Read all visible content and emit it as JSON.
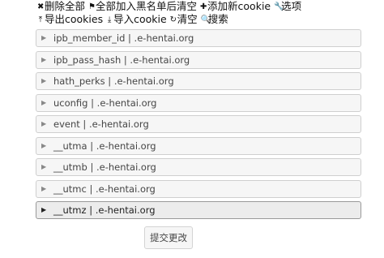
{
  "toolbar": {
    "delete_all": {
      "icon": "✖",
      "label": "删除全部"
    },
    "blacklist_clear": {
      "icon": "⚑",
      "label": "全部加入黑名单后清空"
    },
    "add_cookie": {
      "icon": "✚",
      "label": "添加新cookie"
    },
    "options": {
      "icon": "🔧",
      "label": "选项"
    },
    "export": {
      "icon": "⤒",
      "label": "导出cookies"
    },
    "import": {
      "icon": "⤓",
      "label": "导入cookie"
    },
    "clear": {
      "icon": "↻",
      "label": "清空"
    },
    "search": {
      "icon": "🔍",
      "label": "搜索"
    }
  },
  "cookies": [
    {
      "label": "ipb_member_id | .e-hentai.org"
    },
    {
      "label": "ipb_pass_hash | .e-hentai.org"
    },
    {
      "label": "hath_perks | .e-hentai.org"
    },
    {
      "label": "uconfig | .e-hentai.org"
    },
    {
      "label": "event | .e-hentai.org"
    },
    {
      "label": "__utma | .e-hentai.org"
    },
    {
      "label": "__utmb | .e-hentai.org"
    },
    {
      "label": "__utmc | .e-hentai.org"
    },
    {
      "label": "__utmz | .e-hentai.org",
      "active": true
    }
  ],
  "submit_label": "提交更改"
}
